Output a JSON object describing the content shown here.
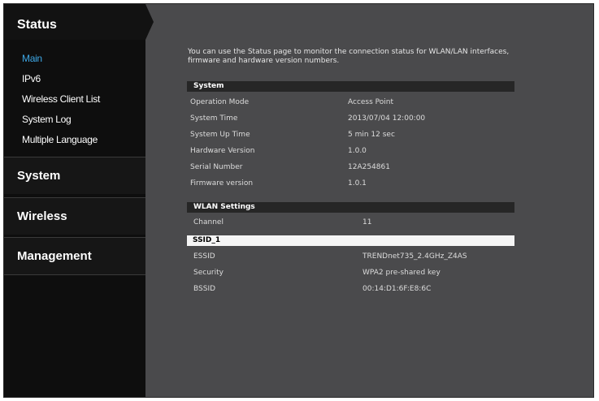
{
  "sidebar": {
    "title": "Status",
    "submenu": [
      "Main",
      "IPv6",
      "Wireless Client List",
      "System Log",
      "Multiple Language"
    ],
    "active_index": 0,
    "sections": [
      "System",
      "Wireless",
      "Management"
    ]
  },
  "main": {
    "intro": "You can use the Status page to monitor the connection status for WLAN/LAN interfaces, firmware and hardware version numbers.",
    "system": {
      "header": "System",
      "rows": [
        {
          "label": "Operation Mode",
          "value": "Access Point"
        },
        {
          "label": "System Time",
          "value": "2013/07/04 12:00:00"
        },
        {
          "label": "System Up Time",
          "value": "5 min 12 sec"
        },
        {
          "label": "Hardware Version",
          "value": "1.0.0"
        },
        {
          "label": "Serial Number",
          "value": "12A254861"
        },
        {
          "label": "Firmware version",
          "value": "1.0.1"
        }
      ]
    },
    "wlan": {
      "header": "WLAN Settings",
      "channel": {
        "label": "Channel",
        "value": "11"
      },
      "ssid_label": "SSID_1",
      "rows": [
        {
          "label": "ESSID",
          "value": "TRENDnet735_2.4GHz_Z4AS"
        },
        {
          "label": "Security",
          "value": "WPA2 pre-shared key"
        },
        {
          "label": "BSSID",
          "value": "00:14:D1:6F:E8:6C"
        }
      ]
    }
  },
  "colors": {
    "active_link": "#3ea8e6",
    "panel_bg": "#4a4a4c",
    "sidebar_bg": "#0e0e0e",
    "header_bar": "#262626"
  }
}
